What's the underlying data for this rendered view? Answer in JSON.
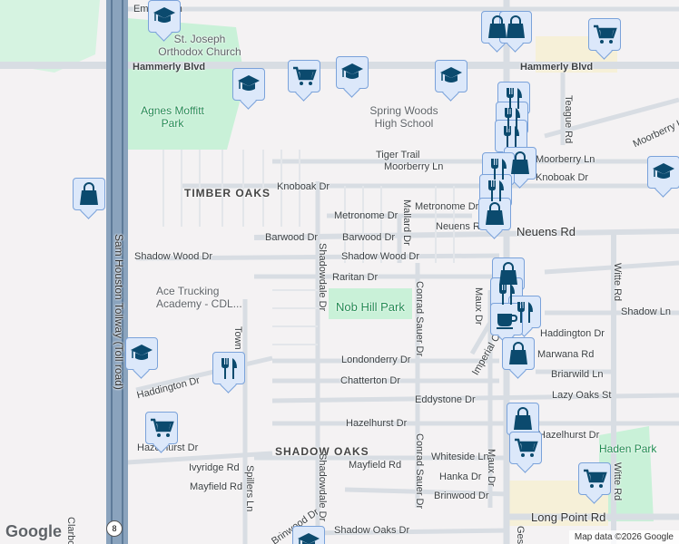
{
  "colors": {
    "marker_bg": "#dce8fa",
    "marker_border": "#7aa2da",
    "icon": "#0b4a6e",
    "park": "#c9f1d8",
    "highway": "#7f9bb8"
  },
  "labels": [
    "Emnora Ln",
    "St. Joseph Orthodox Church",
    "Hammerly Blvd",
    "Hammerly Blvd",
    "Agnes Moffitt Park",
    "Spring Woods High School",
    "Tiger Trail",
    "Moorberry Ln",
    "TIMBER OAKS",
    "Knoboak Dr",
    "Metronome Dr",
    "Metronome Dr",
    "Barwood Dr",
    "Barwood Dr",
    "Neuens Rd",
    "Neuens Rd",
    "Shadow Wood Dr",
    "Shadow Wood Dr",
    "Raritan Dr",
    "Ace Trucking Academy - CDL...",
    "Nob Hill Park",
    "Haddington Dr",
    "Haddington Dr",
    "Londonderry Dr",
    "Chatterton Dr",
    "Eddystone Dr",
    "Lazy Oaks St",
    "Hazelhurst Dr",
    "Hazelhurst Dr",
    "SHADOW OAKS",
    "Whiteside Ln",
    "Mayfield Rd",
    "Mayfield Rd",
    "Ivyridge Rd",
    "Hanka Dr",
    "Brinwood Dr",
    "Brinwood Dr",
    "Shadow Oaks Dr",
    "Long Point Rd",
    "Haden Park",
    "Briarwild Ln",
    "Shadow Ln",
    "Moorberry Ln",
    "Knoboak Dr",
    "Sam Houston Tollway (Toll road)",
    "Shadowdale Dr",
    "Shadowdale Dr",
    "Mallard Dr",
    "Conrad Sauer Dr",
    "Conrad Sauer Dr",
    "Maux Dr",
    "Maux Dr",
    "Imperial Crown",
    "Witte Rd",
    "Witte Rd",
    "Teague Rd",
    "Gessner",
    "Spillers Ln",
    "Town",
    "Moorberry Ln",
    "Marwana Rd",
    "Clarbo"
  ],
  "markers": [
    "school",
    "school",
    "grocery",
    "school",
    "school",
    "shopping",
    "shopping",
    "grocery",
    "restaurant",
    "restaurant",
    "restaurant",
    "shopping",
    "restaurant",
    "restaurant",
    "shopping",
    "school",
    "shopping",
    "shopping",
    "restaurant",
    "restaurant",
    "cafe",
    "shopping",
    "school",
    "restaurant",
    "grocery",
    "shopping",
    "grocery",
    "grocery",
    "school"
  ],
  "attribution": "Map data ©2026 Google",
  "logo": "Google",
  "highway_shield": "8"
}
